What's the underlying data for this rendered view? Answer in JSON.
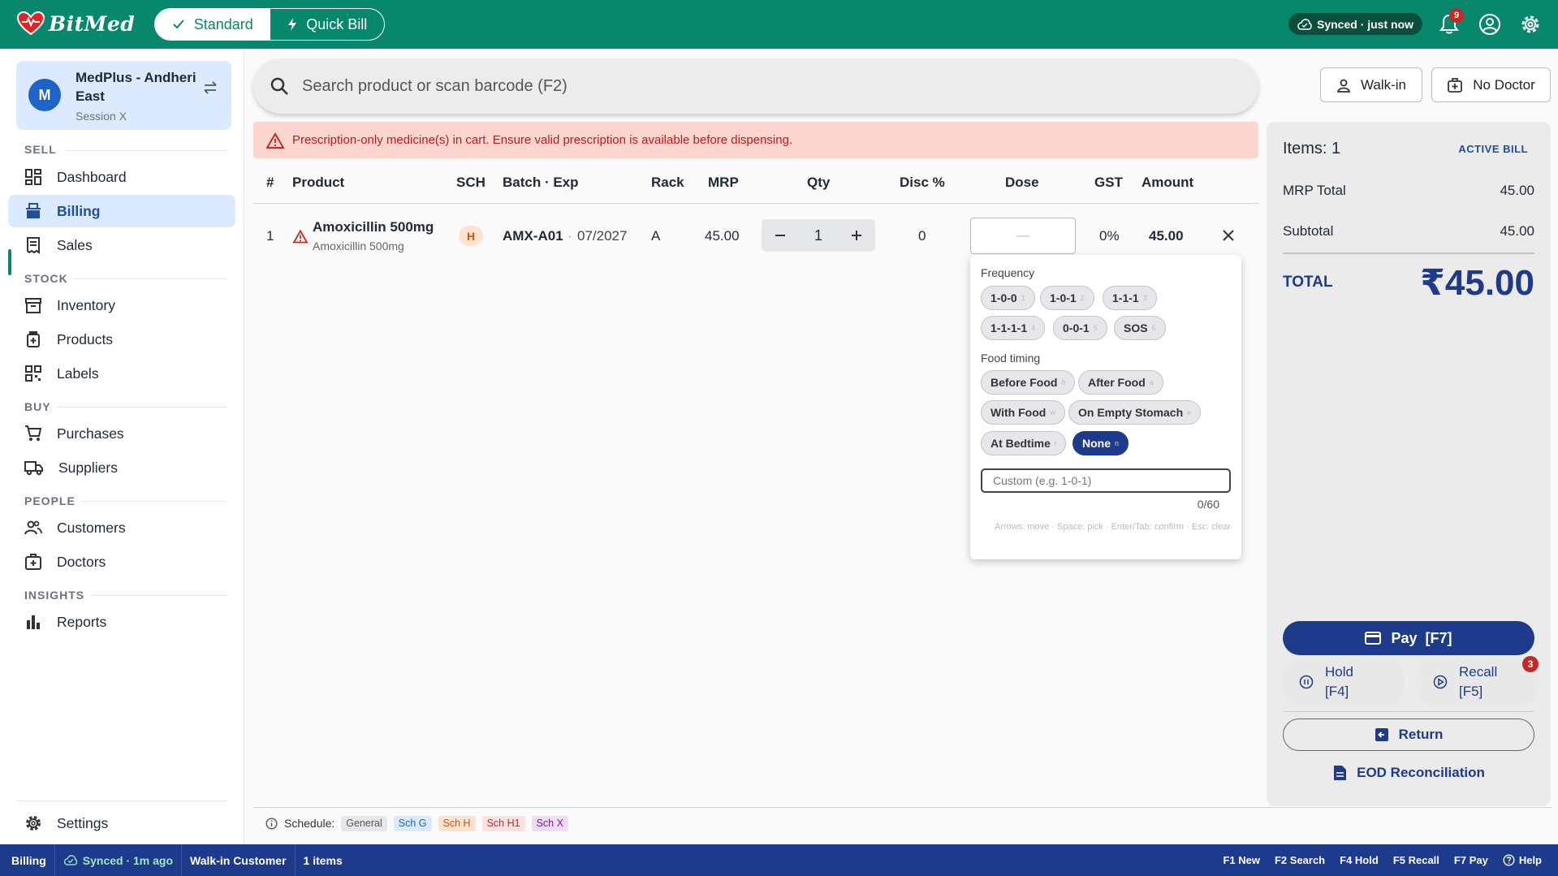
{
  "app": {
    "name": "BitMed"
  },
  "topbar": {
    "modes": [
      {
        "label": "Standard",
        "selected": true
      },
      {
        "label": "Quick Bill",
        "selected": false
      }
    ],
    "sync": "Synced · just now",
    "notifications": "9"
  },
  "sidebar": {
    "store": {
      "initial": "M",
      "name": "MedPlus - Andheri East",
      "session": "Session X"
    },
    "sections": {
      "sell": "SELL",
      "stock": "STOCK",
      "buy": "BUY",
      "people": "PEOPLE",
      "insights": "INSIGHTS"
    },
    "items": [
      {
        "label": "Dashboard",
        "icon": "dashboard-icon"
      },
      {
        "label": "Billing",
        "icon": "billing-icon",
        "active": true
      },
      {
        "label": "Sales",
        "icon": "receipt-icon"
      },
      {
        "label": "Inventory",
        "icon": "inventory-icon"
      },
      {
        "label": "Products",
        "icon": "product-icon"
      },
      {
        "label": "Labels",
        "icon": "qr-icon"
      },
      {
        "label": "Purchases",
        "icon": "cart-icon"
      },
      {
        "label": "Suppliers",
        "icon": "truck-icon"
      },
      {
        "label": "Customers",
        "icon": "people-icon"
      },
      {
        "label": "Doctors",
        "icon": "medical-icon"
      },
      {
        "label": "Reports",
        "icon": "bar-chart-icon"
      }
    ],
    "settings": "Settings"
  },
  "search": {
    "placeholder": "Search product or scan barcode (F2)"
  },
  "header_buttons": {
    "walkin": "Walk-in",
    "doctor": "No Doctor"
  },
  "alert": "Prescription-only medicine(s) in cart. Ensure valid prescription is available before dispensing.",
  "table": {
    "headers": [
      "#",
      "Product",
      "SCH",
      "Batch · Exp",
      "Rack",
      "MRP",
      "Qty",
      "Disc %",
      "Dose",
      "GST",
      "Amount"
    ],
    "rows": [
      {
        "num": "1",
        "name": "Amoxicillin 500mg",
        "generic": "Amoxicillin 500mg",
        "sch": "H",
        "batch": "AMX-A01",
        "exp": "07/2027",
        "rack": "A",
        "mrp": "45.00",
        "qty": "1",
        "disc": "0",
        "dose": "—",
        "gst": "0%",
        "amount": "45.00"
      }
    ]
  },
  "dose_popup": {
    "frequency_label": "Frequency",
    "frequency": [
      {
        "label": "1-0-0",
        "key": "1"
      },
      {
        "label": "1-0-1",
        "key": "2"
      },
      {
        "label": "1-1-1",
        "key": "3"
      },
      {
        "label": "1-1-1-1",
        "key": "4"
      },
      {
        "label": "0-0-1",
        "key": "5"
      },
      {
        "label": "SOS",
        "key": "6"
      }
    ],
    "food_label": "Food timing",
    "food": [
      {
        "label": "Before Food",
        "key": "b"
      },
      {
        "label": "After Food",
        "key": "a"
      },
      {
        "label": "With Food",
        "key": "w"
      },
      {
        "label": "On Empty Stomach",
        "key": "e"
      },
      {
        "label": "At Bedtime",
        "key": "t"
      },
      {
        "label": "None",
        "key": "n",
        "selected": true
      }
    ],
    "custom_placeholder": "Custom (e.g. 1-0-1)",
    "counter": "0/60",
    "hint": "Arrows: move · Space: pick · Enter/Tab: confirm · Esc: clear"
  },
  "legend": {
    "label": "Schedule:",
    "items": [
      "General",
      "Sch G",
      "Sch H",
      "Sch H1",
      "Sch X"
    ]
  },
  "summary": {
    "items": "Items: 1",
    "status": "ACTIVE BILL",
    "mrp_label": "MRP Total",
    "mrp": "45.00",
    "subtotal_label": "Subtotal",
    "subtotal": "45.00",
    "total_label": "TOTAL",
    "total": "₹45.00",
    "pay": "Pay  [F7]",
    "hold": "Hold",
    "hold_key": "[F4]",
    "recall": "Recall",
    "recall_key": "[F5]",
    "recall_count": "3",
    "return": "Return",
    "eod": "EOD Reconciliation"
  },
  "statusbar": {
    "page": "Billing",
    "sync": "Synced · 1m ago",
    "customer": "Walk-in Customer",
    "items": "1 items",
    "shortcuts": [
      "F1 New",
      "F2 Search",
      "F4 Hold",
      "F5 Recall",
      "F7 Pay"
    ],
    "help": "Help"
  },
  "colors": {
    "brand": "#07876b",
    "primary": "#1e3a8a",
    "alert_bg": "#fdd5cf",
    "danger": "#c62828"
  }
}
